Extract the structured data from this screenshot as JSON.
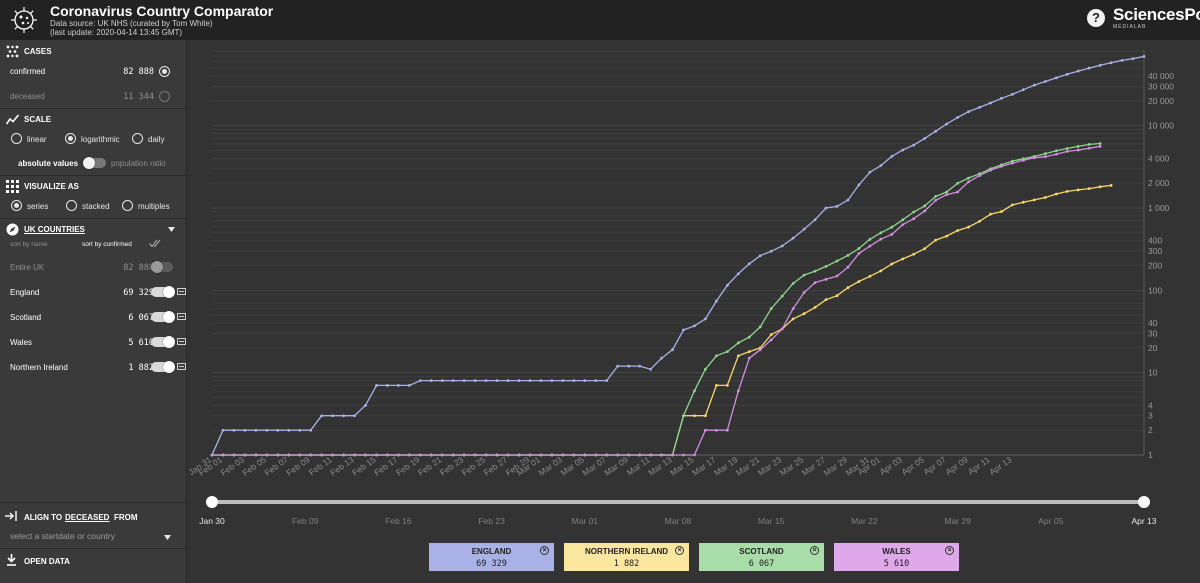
{
  "header": {
    "title": "Coronavirus Country Comparator",
    "source": "Data source: UK NHS (curated by Tom White)",
    "updated": "(last update: 2020-04-14 13:45 GMT)",
    "help": "?",
    "brand": "SciencesPo",
    "brand_sub": "MÉDIALAB"
  },
  "sidebar": {
    "cases": {
      "title": "CASES",
      "confirmed_label": "confirmed",
      "confirmed_value": "82 888",
      "deceased_label": "deceased",
      "deceased_value": "11 344"
    },
    "scale": {
      "title": "SCALE",
      "options": [
        "linear",
        "logarithmic",
        "daily"
      ],
      "selected": "logarithmic",
      "absolute_label": "absolute values",
      "ratio_label": "population ratio"
    },
    "visualize": {
      "title": "VISUALIZE AS",
      "options": [
        "series",
        "stacked",
        "multiples"
      ],
      "selected": "series"
    },
    "countries": {
      "title": "UK COUNTRIES",
      "sort_name": "sort by name",
      "sort_confirmed": "sort by confirmed",
      "entire": {
        "label": "Entire UK",
        "value": "82 888"
      },
      "items": [
        {
          "label": "England",
          "value": "69 329"
        },
        {
          "label": "Scotland",
          "value": "6 067"
        },
        {
          "label": "Wales",
          "value": "5 610"
        },
        {
          "label": "Northern Ireland",
          "value": "1 882"
        }
      ]
    },
    "align": {
      "prefix": "ALIGN TO",
      "link": "DECEASED",
      "suffix": "FROM",
      "placeholder": "select a startdate or country"
    },
    "open_data": "OPEN DATA"
  },
  "slider": {
    "ticks": [
      "Jan 30",
      "Feb 09",
      "Feb 16",
      "Feb 23",
      "Mar 01",
      "Mar 08",
      "Mar 15",
      "Mar 22",
      "Mar 29",
      "Apr 05",
      "Apr 13"
    ],
    "start": "Jan 30",
    "end": "Apr 13"
  },
  "legend": [
    {
      "name": "ENGLAND",
      "value": "69 329",
      "color": "#a9b1e6"
    },
    {
      "name": "NORTHERN IRELAND",
      "value": "1 882",
      "color": "#f9e7a0"
    },
    {
      "name": "SCOTLAND",
      "value": "6 067",
      "color": "#a8dda9"
    },
    {
      "name": "WALES",
      "value": "5 610",
      "color": "#dfa8ea"
    }
  ],
  "chart_data": {
    "type": "line",
    "scale": "log",
    "ylim": [
      1,
      82888
    ],
    "yticks": [
      1,
      2,
      3,
      4,
      10,
      20,
      30,
      40,
      100,
      200,
      300,
      400,
      1000,
      2000,
      4000,
      10000,
      20000,
      30000,
      40000
    ],
    "ytick_labels": [
      "1",
      "2",
      "3",
      "4",
      "10",
      "20",
      "30",
      "40",
      "100",
      "200",
      "300",
      "400",
      "1 000",
      "2 000",
      "4 000",
      "10 000",
      "20 000",
      "30 000",
      "40 000"
    ],
    "x_labels": [
      "Jan 31",
      "Feb 01",
      "Feb 03",
      "Feb 05",
      "Feb 07",
      "Feb 09",
      "Feb 11",
      "Feb 13",
      "Feb 15",
      "Feb 17",
      "Feb 19",
      "Feb 21",
      "Feb 23",
      "Feb 25",
      "Feb 27",
      "Feb 29",
      "Mar 01",
      "Mar 03",
      "Mar 05",
      "Mar 07",
      "Mar 09",
      "Mar 11",
      "Mar 13",
      "Mar 15",
      "Mar 17",
      "Mar 19",
      "Mar 21",
      "Mar 23",
      "Mar 25",
      "Mar 27",
      "Mar 29",
      "Mar 31",
      "Apr 01",
      "Apr 03",
      "Apr 05",
      "Apr 07",
      "Apr 09",
      "Apr 11",
      "Apr 13"
    ],
    "x_start": "2020-01-31",
    "series": [
      {
        "name": "England",
        "color": "#a9b1e6",
        "values": [
          1,
          2,
          2,
          2,
          2,
          2,
          2,
          2,
          2,
          2,
          3,
          3,
          3,
          3,
          4,
          7,
          7,
          7,
          7,
          8,
          8,
          8,
          8,
          8,
          8,
          8,
          8,
          8,
          8,
          8,
          8,
          8,
          8,
          8,
          8,
          8,
          8,
          12,
          12,
          12,
          11,
          15,
          19,
          33,
          37,
          45,
          74,
          115,
          159,
          210,
          263,
          298,
          345,
          430,
          553,
          721,
          1000,
          1046,
          1250,
          1905,
          2722,
          3269,
          4233,
          5062,
          5800,
          7003,
          8546,
          10456,
          12559,
          14798,
          16665,
          18829,
          21468,
          24000,
          27324,
          31020,
          34336,
          38000,
          42000,
          46000,
          50000,
          54000,
          58000,
          62000,
          65000,
          69329
        ]
      },
      {
        "name": "Northern Ireland",
        "color": "#f6d76a",
        "values": [
          1,
          1,
          1,
          1,
          1,
          1,
          1,
          1,
          1,
          1,
          1,
          1,
          1,
          1,
          1,
          1,
          1,
          1,
          1,
          1,
          1,
          1,
          1,
          1,
          1,
          1,
          1,
          1,
          1,
          1,
          1,
          1,
          1,
          1,
          1,
          1,
          1,
          1,
          1,
          1,
          1,
          1,
          1,
          3,
          3,
          3,
          7,
          7,
          16,
          18,
          20,
          29,
          34,
          45,
          52,
          62,
          77,
          86,
          108,
          128,
          148,
          172,
          209,
          241,
          274,
          321,
          407,
          455,
          533,
          586,
          689,
          841,
          904,
          1089,
          1176,
          1255,
          1339,
          1477,
          1589,
          1656,
          1717,
          1806,
          1882
        ]
      },
      {
        "name": "Scotland",
        "color": "#8fd58f",
        "values": [
          1,
          1,
          1,
          1,
          1,
          1,
          1,
          1,
          1,
          1,
          1,
          1,
          1,
          1,
          1,
          1,
          1,
          1,
          1,
          1,
          1,
          1,
          1,
          1,
          1,
          1,
          1,
          1,
          1,
          1,
          1,
          1,
          1,
          1,
          1,
          1,
          1,
          1,
          1,
          1,
          1,
          1,
          1,
          3,
          6,
          11,
          16,
          18,
          23,
          27,
          36,
          60,
          85,
          121,
          153,
          171,
          195,
          227,
          266,
          322,
          416,
          499,
          584,
          719,
          894,
          1059,
          1384,
          1563,
          1993,
          2310,
          2602,
          2993,
          3345,
          3706,
          3961,
          4229,
          4565,
          4957,
          5275,
          5590,
          5912,
          6067
        ]
      },
      {
        "name": "Wales",
        "color": "#d08ee0",
        "values": [
          1,
          1,
          1,
          1,
          1,
          1,
          1,
          1,
          1,
          1,
          1,
          1,
          1,
          1,
          1,
          1,
          1,
          1,
          1,
          1,
          1,
          1,
          1,
          1,
          1,
          1,
          1,
          1,
          1,
          1,
          1,
          1,
          1,
          1,
          1,
          1,
          1,
          1,
          1,
          1,
          1,
          1,
          1,
          1,
          1,
          2,
          2,
          2,
          6,
          15,
          19,
          25,
          34,
          60,
          94,
          124,
          136,
          149,
          191,
          280,
          344,
          418,
          478,
          628,
          741,
          919,
          1241,
          1451,
          1563,
          2080,
          2466,
          2877,
          3199,
          3498,
          3790,
          4073,
          4196,
          4489,
          4866,
          5048,
          5318,
          5610
        ]
      }
    ]
  }
}
